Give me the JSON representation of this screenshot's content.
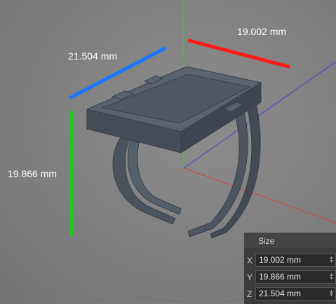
{
  "viewport": {
    "dimension_x_label": "19.002 mm",
    "dimension_y_label": "19.866 mm",
    "dimension_z_label": "21.504 mm",
    "colors": {
      "x_axis": "#ff1a1a",
      "y_axis": "#1ec81e",
      "z_axis": "#1a78ff",
      "background": "#7f7f7f",
      "model": "#4d5560"
    }
  },
  "size_panel": {
    "title": "Size",
    "rows": [
      {
        "axis": "X",
        "value": "19.002 mm"
      },
      {
        "axis": "Y",
        "value": "19.866 mm"
      },
      {
        "axis": "Z",
        "value": "21.504 mm"
      }
    ]
  }
}
